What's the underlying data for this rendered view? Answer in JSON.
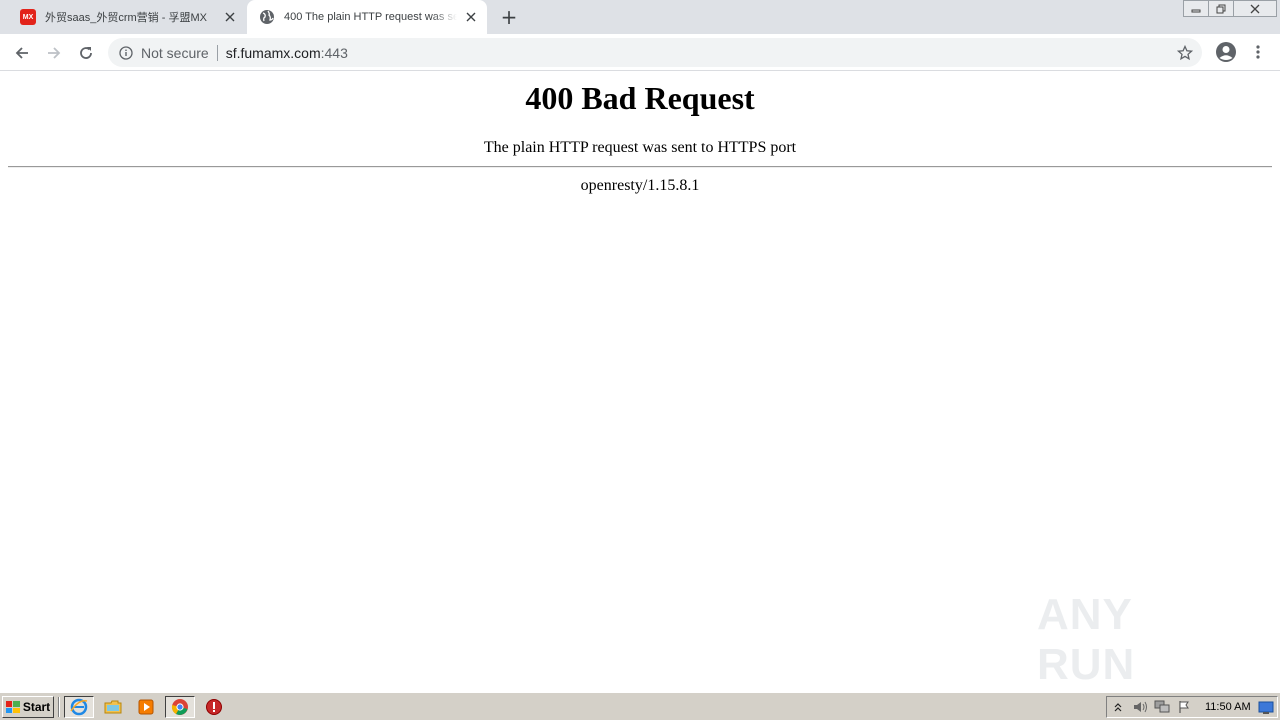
{
  "browser": {
    "tabs": [
      {
        "title": "外贸saas_外贸crm营销 - 孚盟MX",
        "favicon": "mx-logo",
        "favicon_text": "MX",
        "active": false
      },
      {
        "title": "400 The plain HTTP request was sent to HTTPS port",
        "favicon": "globe-icon",
        "active": true
      }
    ],
    "new_tab_label": "+",
    "address_bar": {
      "security_label": "Not secure",
      "url_host": "sf.fumamx.com",
      "url_port": ":443"
    }
  },
  "page": {
    "heading": "400 Bad Request",
    "message": "The plain HTTP request was sent to HTTPS port",
    "server": "openresty/1.15.8.1"
  },
  "watermark": {
    "text": "ANY RUN"
  },
  "taskbar": {
    "start_label": "Start",
    "clock": "11:50 AM",
    "pinned": [
      "internet-explorer-icon",
      "folder-icon",
      "media-player-icon",
      "chrome-icon",
      "stop-icon"
    ]
  },
  "colors": {
    "tabstrip_bg": "#dee1e6",
    "omnibox_bg": "#f1f3f4",
    "mx_brand": "#e2231a",
    "taskbar_bg": "#d4d0c8"
  }
}
